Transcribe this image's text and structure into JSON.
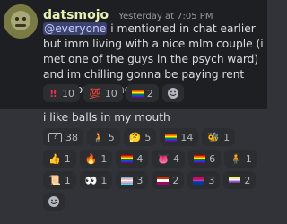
{
  "message1": {
    "username": "datsmojo",
    "timestamp": "Yesterday at 7:05 PM",
    "mention": "@everyone",
    "text": "i mentioned in chat earlier but imm living with a nice mlm couple (i met one of the guys in the psych ward) and im chilling gonna be paying rent and workinf and shit",
    "reactions": [
      {
        "icon": "double-exclamation-icon",
        "glyph": "‼",
        "count": "10"
      },
      {
        "icon": "hundred-points-icon",
        "glyph": "💯",
        "count": "10"
      },
      {
        "icon": "pride-flag-icon",
        "glyph": "",
        "count": "2"
      }
    ]
  },
  "message2": {
    "text": "i like balls in my mouth",
    "reactions_row1": [
      {
        "icon": "question-mark-icon",
        "glyph": "?",
        "count": "38"
      },
      {
        "icon": "person-icon",
        "glyph": "🧎",
        "count": "5"
      },
      {
        "icon": "thinking-face-icon",
        "glyph": "🤔",
        "count": "5"
      },
      {
        "icon": "pride-flag-icon",
        "glyph": "",
        "count": "14"
      },
      {
        "icon": "bee-icon",
        "glyph": "🐝",
        "count": "1"
      }
    ],
    "reactions_row2": [
      {
        "icon": "thumbs-up-icon",
        "glyph": "👍",
        "count": "1"
      },
      {
        "icon": "fire-icon",
        "glyph": "🔥",
        "count": "1"
      },
      {
        "icon": "pride-flag-icon",
        "glyph": "",
        "count": "4"
      },
      {
        "icon": "tongue-icon",
        "glyph": "👅",
        "count": "4"
      },
      {
        "icon": "pride-flag-icon",
        "glyph": "",
        "count": "6"
      },
      {
        "icon": "person-standing-icon",
        "glyph": "🧍",
        "count": "1"
      }
    ],
    "reactions_row3": [
      {
        "icon": "custom-emoji-icon",
        "glyph": "📜",
        "count": "1"
      },
      {
        "icon": "eyes-icon",
        "glyph": "👀",
        "count": "1"
      },
      {
        "icon": "trans-flag-icon",
        "glyph": "",
        "count": "3"
      },
      {
        "icon": "flag-icon",
        "glyph": "",
        "count": "2"
      },
      {
        "icon": "bi-flag-icon",
        "glyph": "",
        "count": "3"
      },
      {
        "icon": "nonbinary-flag-icon",
        "glyph": "",
        "count": "2"
      }
    ]
  },
  "colors": {
    "background": "#313338",
    "highlight": "#1e1f22",
    "username": "#e6f0b4",
    "mention_bg": "#3c4270"
  }
}
